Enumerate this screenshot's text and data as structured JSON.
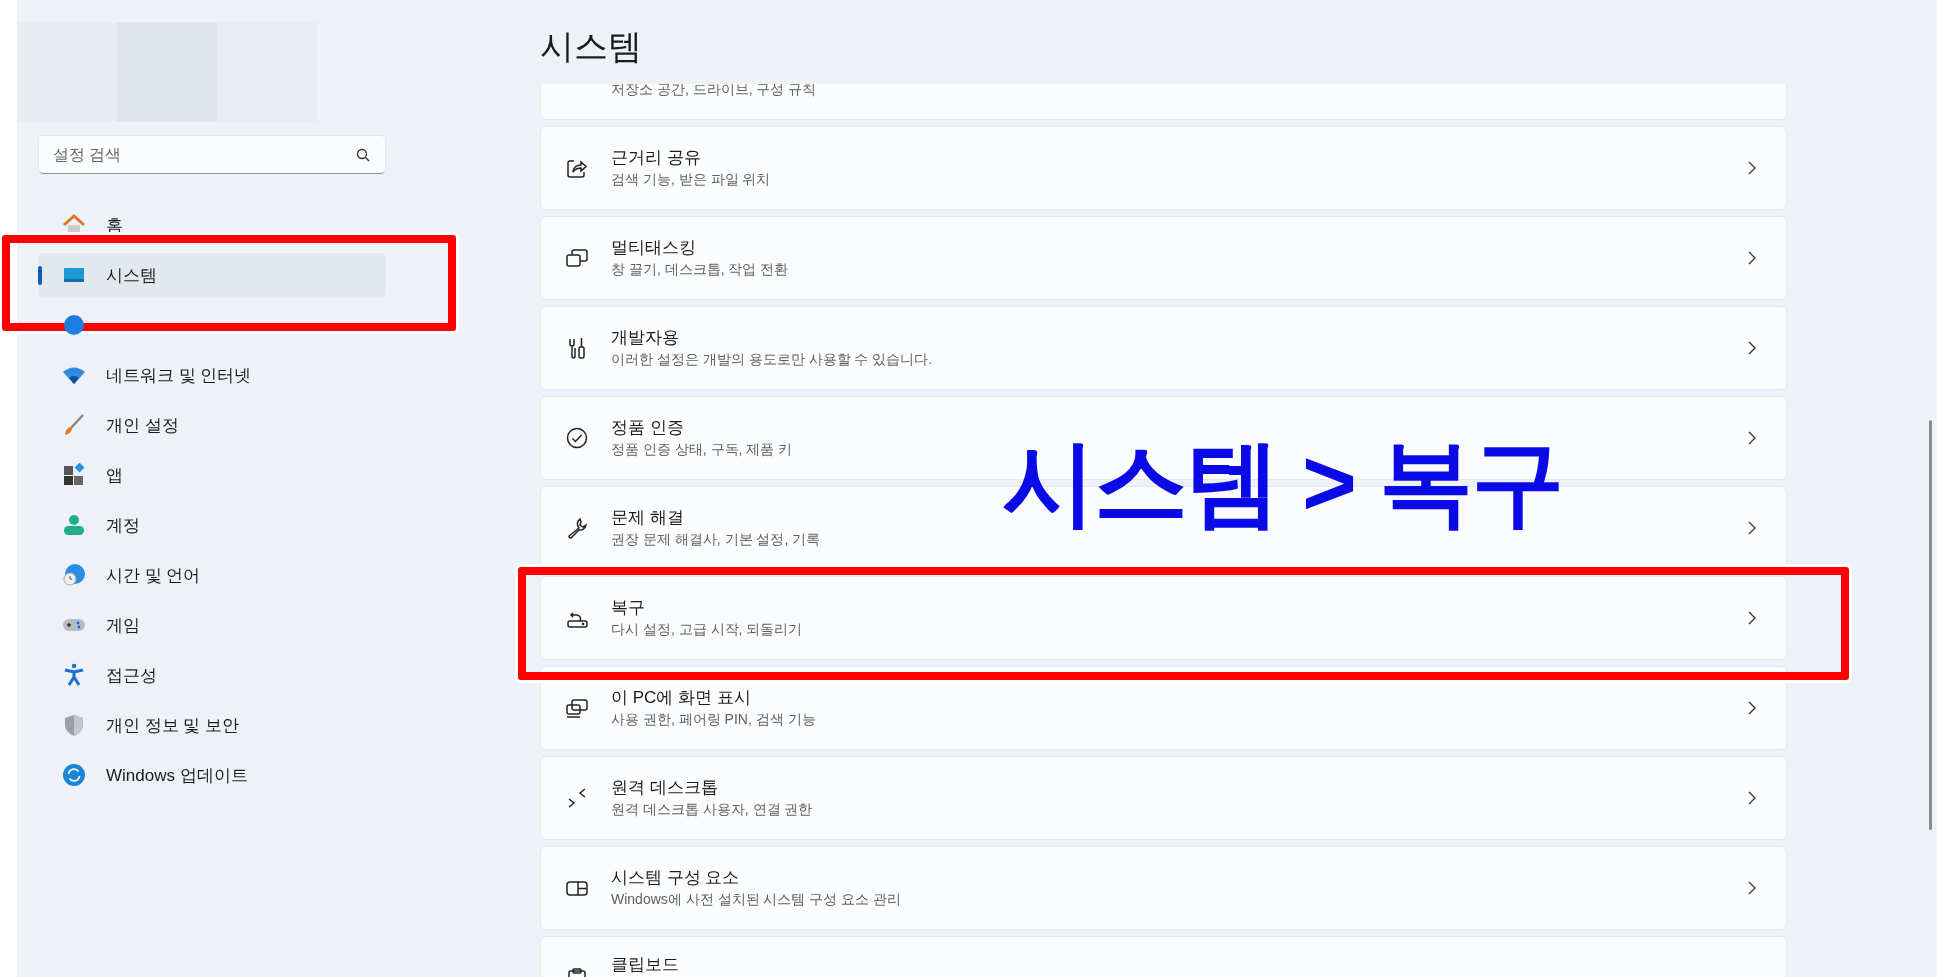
{
  "sidebar": {
    "search": {
      "placeholder": "설정 검색"
    },
    "items": [
      {
        "kind": "home",
        "label": "홈",
        "selected": false,
        "highlighted": false
      },
      {
        "kind": "system",
        "label": "시스템",
        "selected": true,
        "highlighted": true
      },
      {
        "kind": "bluetooth",
        "selected": false,
        "highlighted": false
      },
      {
        "kind": "network",
        "label": "네트워크 및 인터넷",
        "selected": false,
        "highlighted": false
      },
      {
        "kind": "personalize",
        "label": "개인 설정",
        "selected": false,
        "highlighted": false
      },
      {
        "kind": "apps",
        "label": "앱",
        "selected": false,
        "highlighted": false
      },
      {
        "kind": "account",
        "label": "계정",
        "selected": false,
        "highlighted": false
      },
      {
        "kind": "time",
        "label": "시간 및 언어",
        "selected": false,
        "highlighted": false
      },
      {
        "kind": "gaming",
        "label": "게임",
        "selected": false,
        "highlighted": false
      },
      {
        "kind": "accessibility",
        "label": "접근성",
        "selected": false,
        "highlighted": false
      },
      {
        "kind": "privacy",
        "label": "개인 정보 및 보안",
        "selected": false,
        "highlighted": false
      },
      {
        "kind": "update",
        "label": "Windows 업데이트",
        "selected": false,
        "highlighted": false
      }
    ]
  },
  "main": {
    "title": "시스템",
    "cards": [
      {
        "kind": "storage",
        "subtitle": "저장소 공간, 드라이브, 구성 규칙",
        "highlighted": false
      },
      {
        "kind": "share",
        "title": "근거리 공유",
        "subtitle": "검색 기능, 받은 파일 위치",
        "highlighted": false
      },
      {
        "kind": "multitask",
        "title": "멀티태스킹",
        "subtitle": "창 끌기, 데스크톱, 작업 전환",
        "highlighted": false
      },
      {
        "kind": "developer",
        "title": "개발자용",
        "subtitle": "이러한 설정은 개발의 용도로만 사용할 수 있습니다.",
        "highlighted": false
      },
      {
        "kind": "activation",
        "title": "정품 인증",
        "subtitle": "정품 인증 상태, 구독, 제품 키",
        "highlighted": false
      },
      {
        "kind": "troubleshoot",
        "title": "문제 해결",
        "subtitle": "권장 문제 해결사, 기본 설정, 기록",
        "highlighted": false
      },
      {
        "kind": "recovery",
        "title": "복구",
        "subtitle": "다시 설정, 고급 시작, 되돌리기",
        "highlighted": true
      },
      {
        "kind": "projecting",
        "title": "이 PC에 화면 표시",
        "subtitle": "사용 권한, 페어링 PIN, 검색 기능",
        "highlighted": false
      },
      {
        "kind": "remote",
        "title": "원격 데스크톱",
        "subtitle": "원격 데스크톱 사용자, 연결 권한",
        "highlighted": false
      },
      {
        "kind": "components",
        "title": "시스템 구성 요소",
        "subtitle": "Windows에 사전 설치된 시스템 구성 요소 관리",
        "highlighted": false
      },
      {
        "kind": "clipboard",
        "title": "클립보드",
        "highlighted": false
      }
    ]
  },
  "annotation": {
    "label": "시스템 > 복구"
  }
}
